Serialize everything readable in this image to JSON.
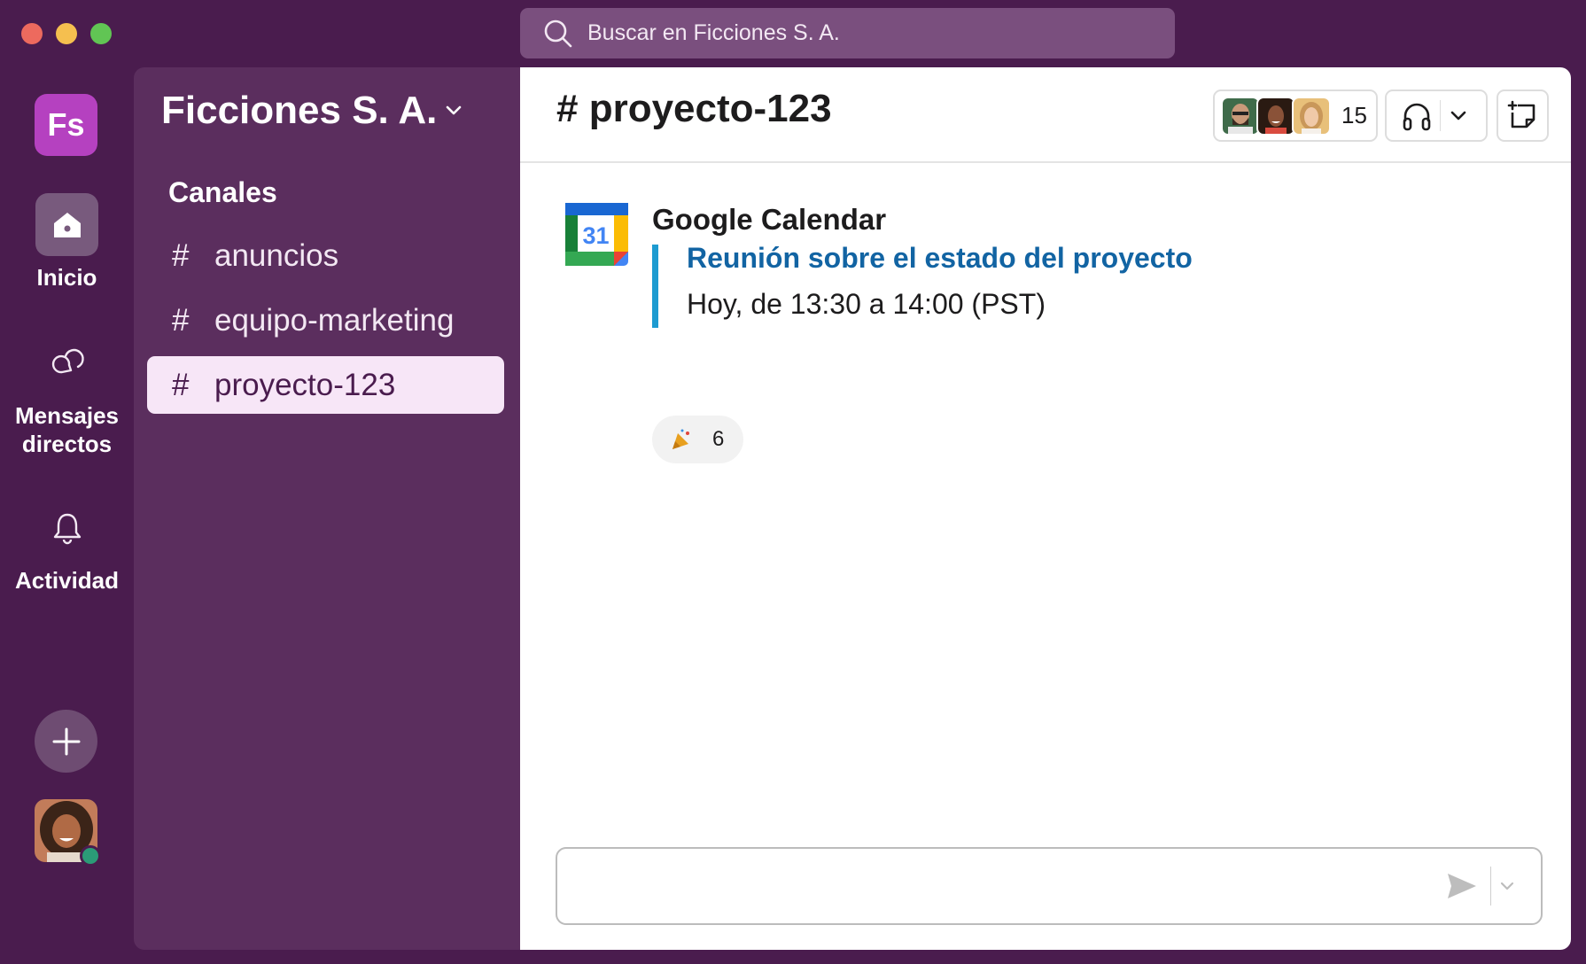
{
  "search": {
    "placeholder": "Buscar en Ficciones S. A."
  },
  "rail": {
    "workspace_initials": "Fs",
    "items": [
      {
        "label": "Inicio",
        "icon": "home-icon",
        "active": true
      },
      {
        "label": "Mensajes directos",
        "icon": "chat-bubbles-icon"
      },
      {
        "label": "Actividad",
        "icon": "bell-icon"
      }
    ],
    "status_color": "#2b9b77"
  },
  "sidebar": {
    "workspace_name": "Ficciones S. A.",
    "section_title": "Canales",
    "channels": [
      {
        "hash": "#",
        "name": "anuncios"
      },
      {
        "hash": "#",
        "name": "equipo-marketing"
      },
      {
        "hash": "#",
        "name": "proyecto-123",
        "selected": true
      }
    ]
  },
  "channel": {
    "title": "# proyecto-123",
    "member_count": "15"
  },
  "message": {
    "sender": "Google Calendar",
    "app_icon_text": "31",
    "event_title": "Reunión sobre el estado del proyecto",
    "event_time": "Hoy, de 13:30 a 14:00 (PST)",
    "reaction_emoji": "party-popper-icon",
    "reaction_count": "6"
  },
  "composer": {
    "value": ""
  },
  "colors": {
    "aubergine": "#4a1c4e",
    "sidebar": "#5b2e5e",
    "selected_channel": "#f7e6f7",
    "link_blue": "#1264a3",
    "attachment_bar": "#1d9bd1"
  }
}
